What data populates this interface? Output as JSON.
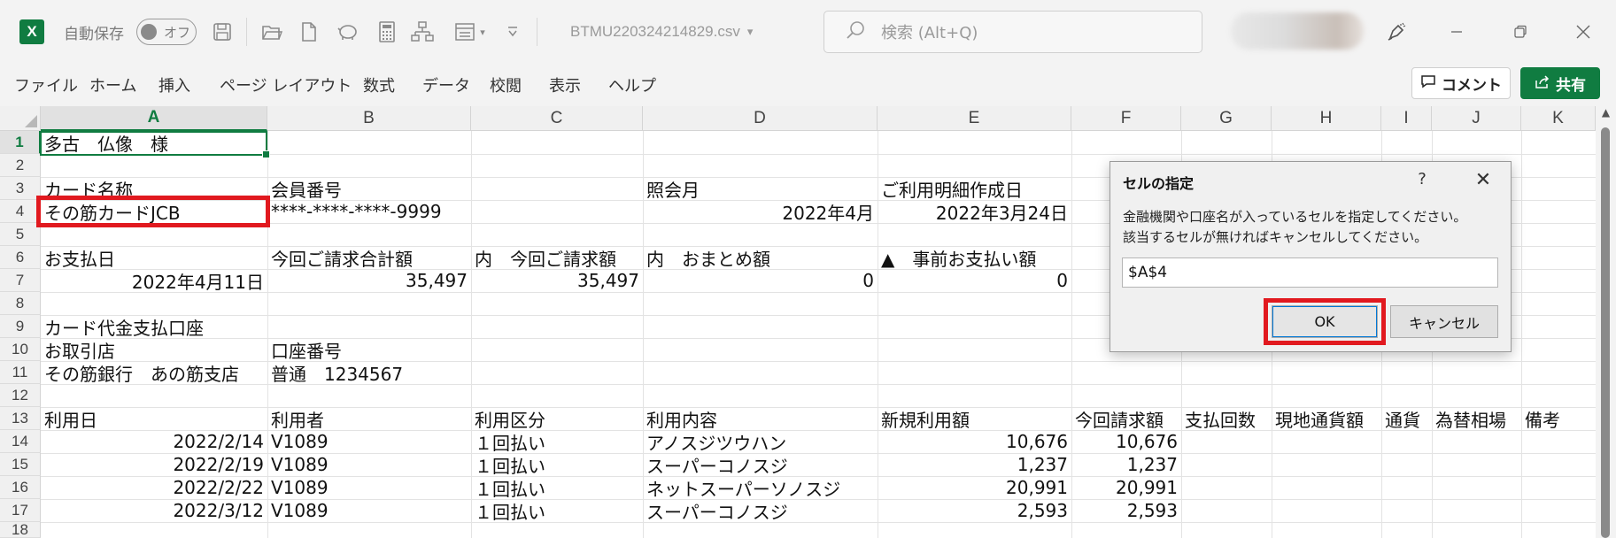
{
  "titlebar": {
    "app_icon": "excel-logo",
    "app_letter": "X",
    "autosave_label": "自動保存",
    "autosave_state": "オフ",
    "filename": "BTMU220324214829.csv",
    "filename_caret": "▾",
    "search_placeholder": "検索 (Alt+Q)",
    "icons": [
      "save-icon",
      "open-folder-icon",
      "new-file-icon",
      "piggy-bank-icon",
      "calculator-icon",
      "org-chart-icon",
      "form-icon",
      "customize-toolbar-icon",
      "pen-icon",
      "minimize-icon",
      "restore-icon",
      "close-icon"
    ]
  },
  "menu": {
    "items": [
      "ファイル",
      "ホーム",
      "挿入",
      "ページ レイアウト",
      "数式",
      "データ",
      "校閲",
      "表示",
      "ヘルプ"
    ],
    "comment_label": "コメント",
    "share_label": "共有"
  },
  "sheet": {
    "columns": [
      "A",
      "B",
      "C",
      "D",
      "E",
      "F",
      "G",
      "H",
      "I",
      "J",
      "K"
    ],
    "selected_column": "A",
    "rows": [
      "1",
      "2",
      "3",
      "4",
      "5",
      "6",
      "7",
      "8",
      "9",
      "10",
      "11",
      "12",
      "13",
      "14",
      "15",
      "16",
      "17",
      "18"
    ],
    "selected_row": "1",
    "active_cell": "A1",
    "cells": {
      "r1": {
        "A": "多古　仏像　様"
      },
      "r3": {
        "A": "カード名称",
        "B": "会員番号",
        "D": "照会月",
        "E": "ご利用明細作成日"
      },
      "r4": {
        "A": "その筋カードJCB",
        "B": "****-****-****-9999",
        "D": "2022年4月",
        "E": "2022年3月24日"
      },
      "r6": {
        "A": "お支払日",
        "B": "今回ご請求合計額",
        "C": "内　今回ご請求額",
        "D": "内　おまとめ額",
        "E": "▲　事前お支払い額"
      },
      "r7": {
        "A": "2022年4月11日",
        "B": "35,497",
        "C": "35,497",
        "D": "0",
        "E": "0"
      },
      "r9": {
        "A": "カード代金支払口座"
      },
      "r10": {
        "A": "お取引店",
        "B": "口座番号"
      },
      "r11": {
        "A": "その筋銀行　あの筋支店",
        "B": "普通　1234567"
      },
      "r13": {
        "A": "利用日",
        "B": "利用者",
        "C": "利用区分",
        "D": "利用内容",
        "E": "新規利用額",
        "F": "今回請求額",
        "G": "支払回数",
        "H": "現地通貨額",
        "I": "通貨",
        "J": "為替相場",
        "K": "備考"
      },
      "r14": {
        "A": "2022/2/14",
        "B": "V1089",
        "C": "１回払い",
        "D": "アノスジツウハン",
        "E": "10,676",
        "F": "10,676"
      },
      "r15": {
        "A": "2022/2/19",
        "B": "V1089",
        "C": "１回払い",
        "D": "スーパーコノスジ",
        "E": "1,237",
        "F": "1,237"
      },
      "r16": {
        "A": "2022/2/22",
        "B": "V1089",
        "C": "１回払い",
        "D": "ネットスーパーソノスジ",
        "E": "20,991",
        "F": "20,991"
      },
      "r17": {
        "A": "2022/3/12",
        "B": "V1089",
        "C": "１回払い",
        "D": "スーパーコノスジ",
        "E": "2,593",
        "F": "2,593"
      }
    }
  },
  "dialog": {
    "title": "セルの指定",
    "help": "?",
    "close": "✕",
    "message_line1": "金融機関や口座名が入っているセルを指定してください。",
    "message_line2": "該当するセルが無ければキャンセルしてください。",
    "input_value": "$A$4",
    "ok_label": "OK",
    "cancel_label": "キャンセル"
  },
  "highlight_color": "#e1191f",
  "accent_color": "#107c41"
}
